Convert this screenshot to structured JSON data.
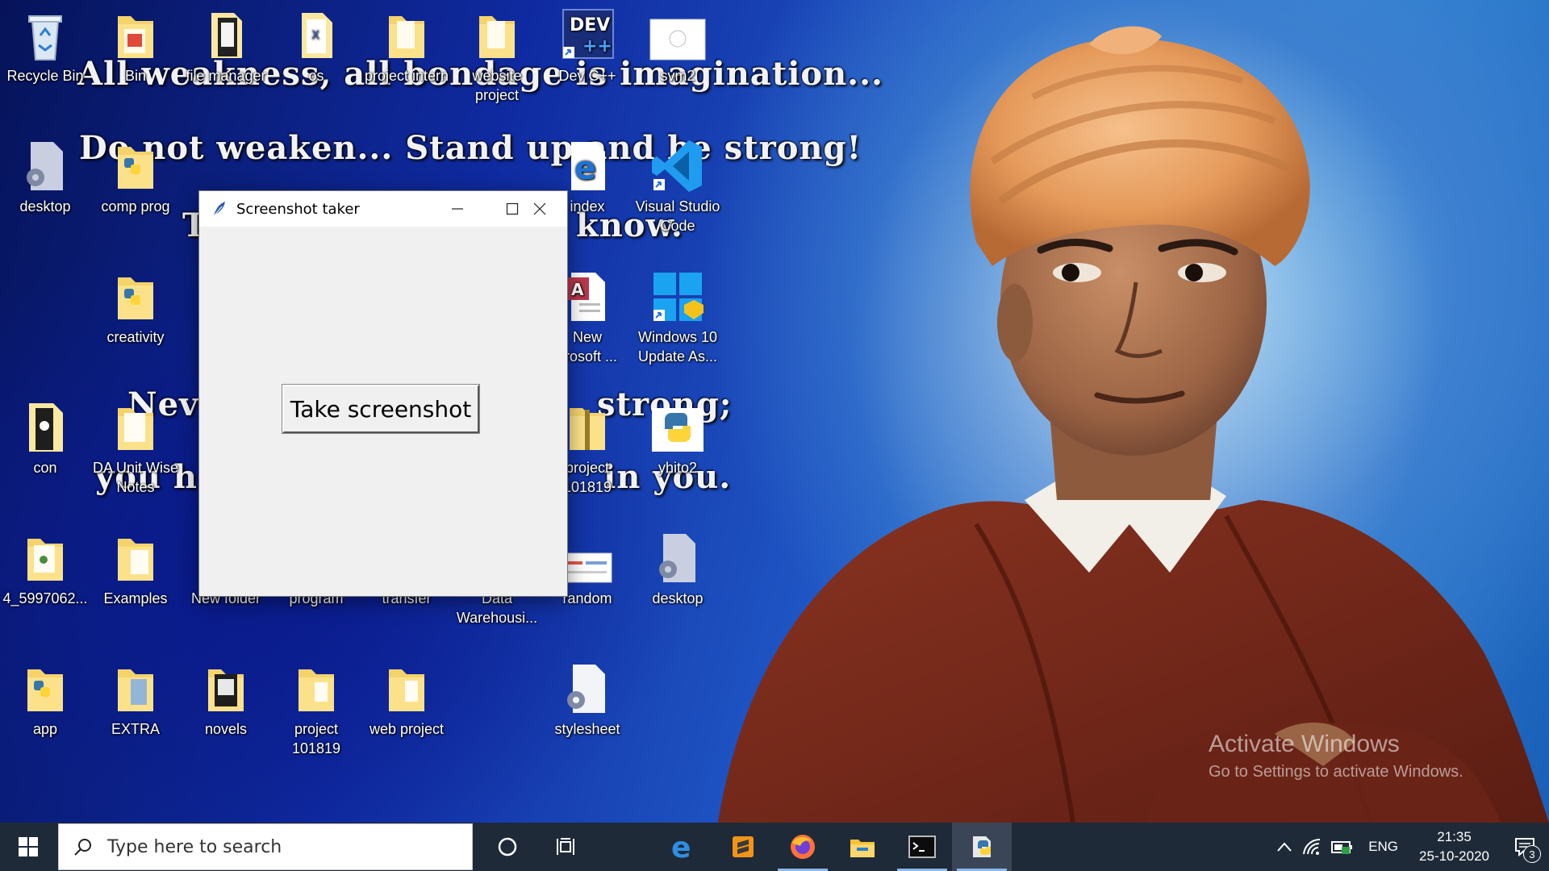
{
  "wallpaper": {
    "quote_lines": [
      "All weakness, all bondage is imagination...",
      "Do not weaken... Stand up and be strong!",
      "know.",
      "Never",
      "strong;",
      "you h",
      "in you.",
      "T"
    ]
  },
  "desktop_icons": [
    {
      "label": "Recycle Bin",
      "icon": "recycle-bin-icon"
    },
    {
      "label": "Bin",
      "icon": "folder-icon"
    },
    {
      "label": "file manager",
      "icon": "file-icon"
    },
    {
      "label": "os",
      "icon": "file-icon"
    },
    {
      "label": "project intern",
      "icon": "folder-icon"
    },
    {
      "label": "website project",
      "icon": "folder-icon"
    },
    {
      "label": "Dev C++",
      "icon": "devcpp-icon"
    },
    {
      "label": "svm2",
      "icon": "image-icon"
    },
    {
      "label": "desktop",
      "icon": "settings-file-icon"
    },
    {
      "label": "comp prog",
      "icon": "python-folder-icon"
    },
    {
      "label": "index",
      "icon": "edge-legacy-icon"
    },
    {
      "label": "Visual Studio Code",
      "icon": "vscode-icon"
    },
    {
      "label": "creativity",
      "icon": "python-folder-icon"
    },
    {
      "label": "New Microsoft ...",
      "label_visible": "New\ncrosoft ...",
      "icon": "access-icon"
    },
    {
      "label": "Windows 10 Update As...",
      "icon": "windows-icon"
    },
    {
      "label": "con",
      "icon": "file-icon"
    },
    {
      "label": "DA Unit Wise Notes",
      "icon": "folder-icon"
    },
    {
      "label": "project 101819",
      "label_visible": "project\n101819",
      "icon": "zip-folder-icon"
    },
    {
      "label": "yhito2",
      "icon": "python-icon"
    },
    {
      "label": "4_5997062...",
      "icon": "folder-icon"
    },
    {
      "label": "Examples",
      "icon": "folder-icon"
    },
    {
      "label": "New folder",
      "icon": "folder-icon"
    },
    {
      "label": "program",
      "icon": "folder-icon"
    },
    {
      "label": "transfer",
      "icon": "folder-icon"
    },
    {
      "label": "Data Warehousi...",
      "icon": "folder-icon"
    },
    {
      "label": "random",
      "icon": "image-icon"
    },
    {
      "label": "desktop",
      "icon": "settings-file-icon"
    },
    {
      "label": "app",
      "icon": "python-folder-icon"
    },
    {
      "label": "EXTRA",
      "icon": "folder-icon"
    },
    {
      "label": "novels",
      "icon": "folder-icon"
    },
    {
      "label": "project 101819",
      "icon": "folder-icon"
    },
    {
      "label": "web project",
      "icon": "folder-icon"
    },
    {
      "label": "stylesheet",
      "icon": "settings-file-icon"
    }
  ],
  "app_window": {
    "title": "Screenshot taker",
    "button_label": "Take screenshot"
  },
  "watermark": {
    "line1": "Activate Windows",
    "line2": "Go to Settings to activate Windows."
  },
  "taskbar": {
    "search_placeholder": "Type here to search",
    "language": "ENG",
    "time": "21:35",
    "date": "25-10-2020",
    "notification_count": "3",
    "pinned": [
      "edge-icon",
      "sublime-text-icon",
      "firefox-icon",
      "file-explorer-icon",
      "terminal-icon",
      "python-app-icon"
    ]
  },
  "colors": {
    "taskbar": "#1f2a38",
    "window_bg": "#f0f0f0",
    "turban": "#e8a060",
    "robe": "#7a2a1c"
  }
}
